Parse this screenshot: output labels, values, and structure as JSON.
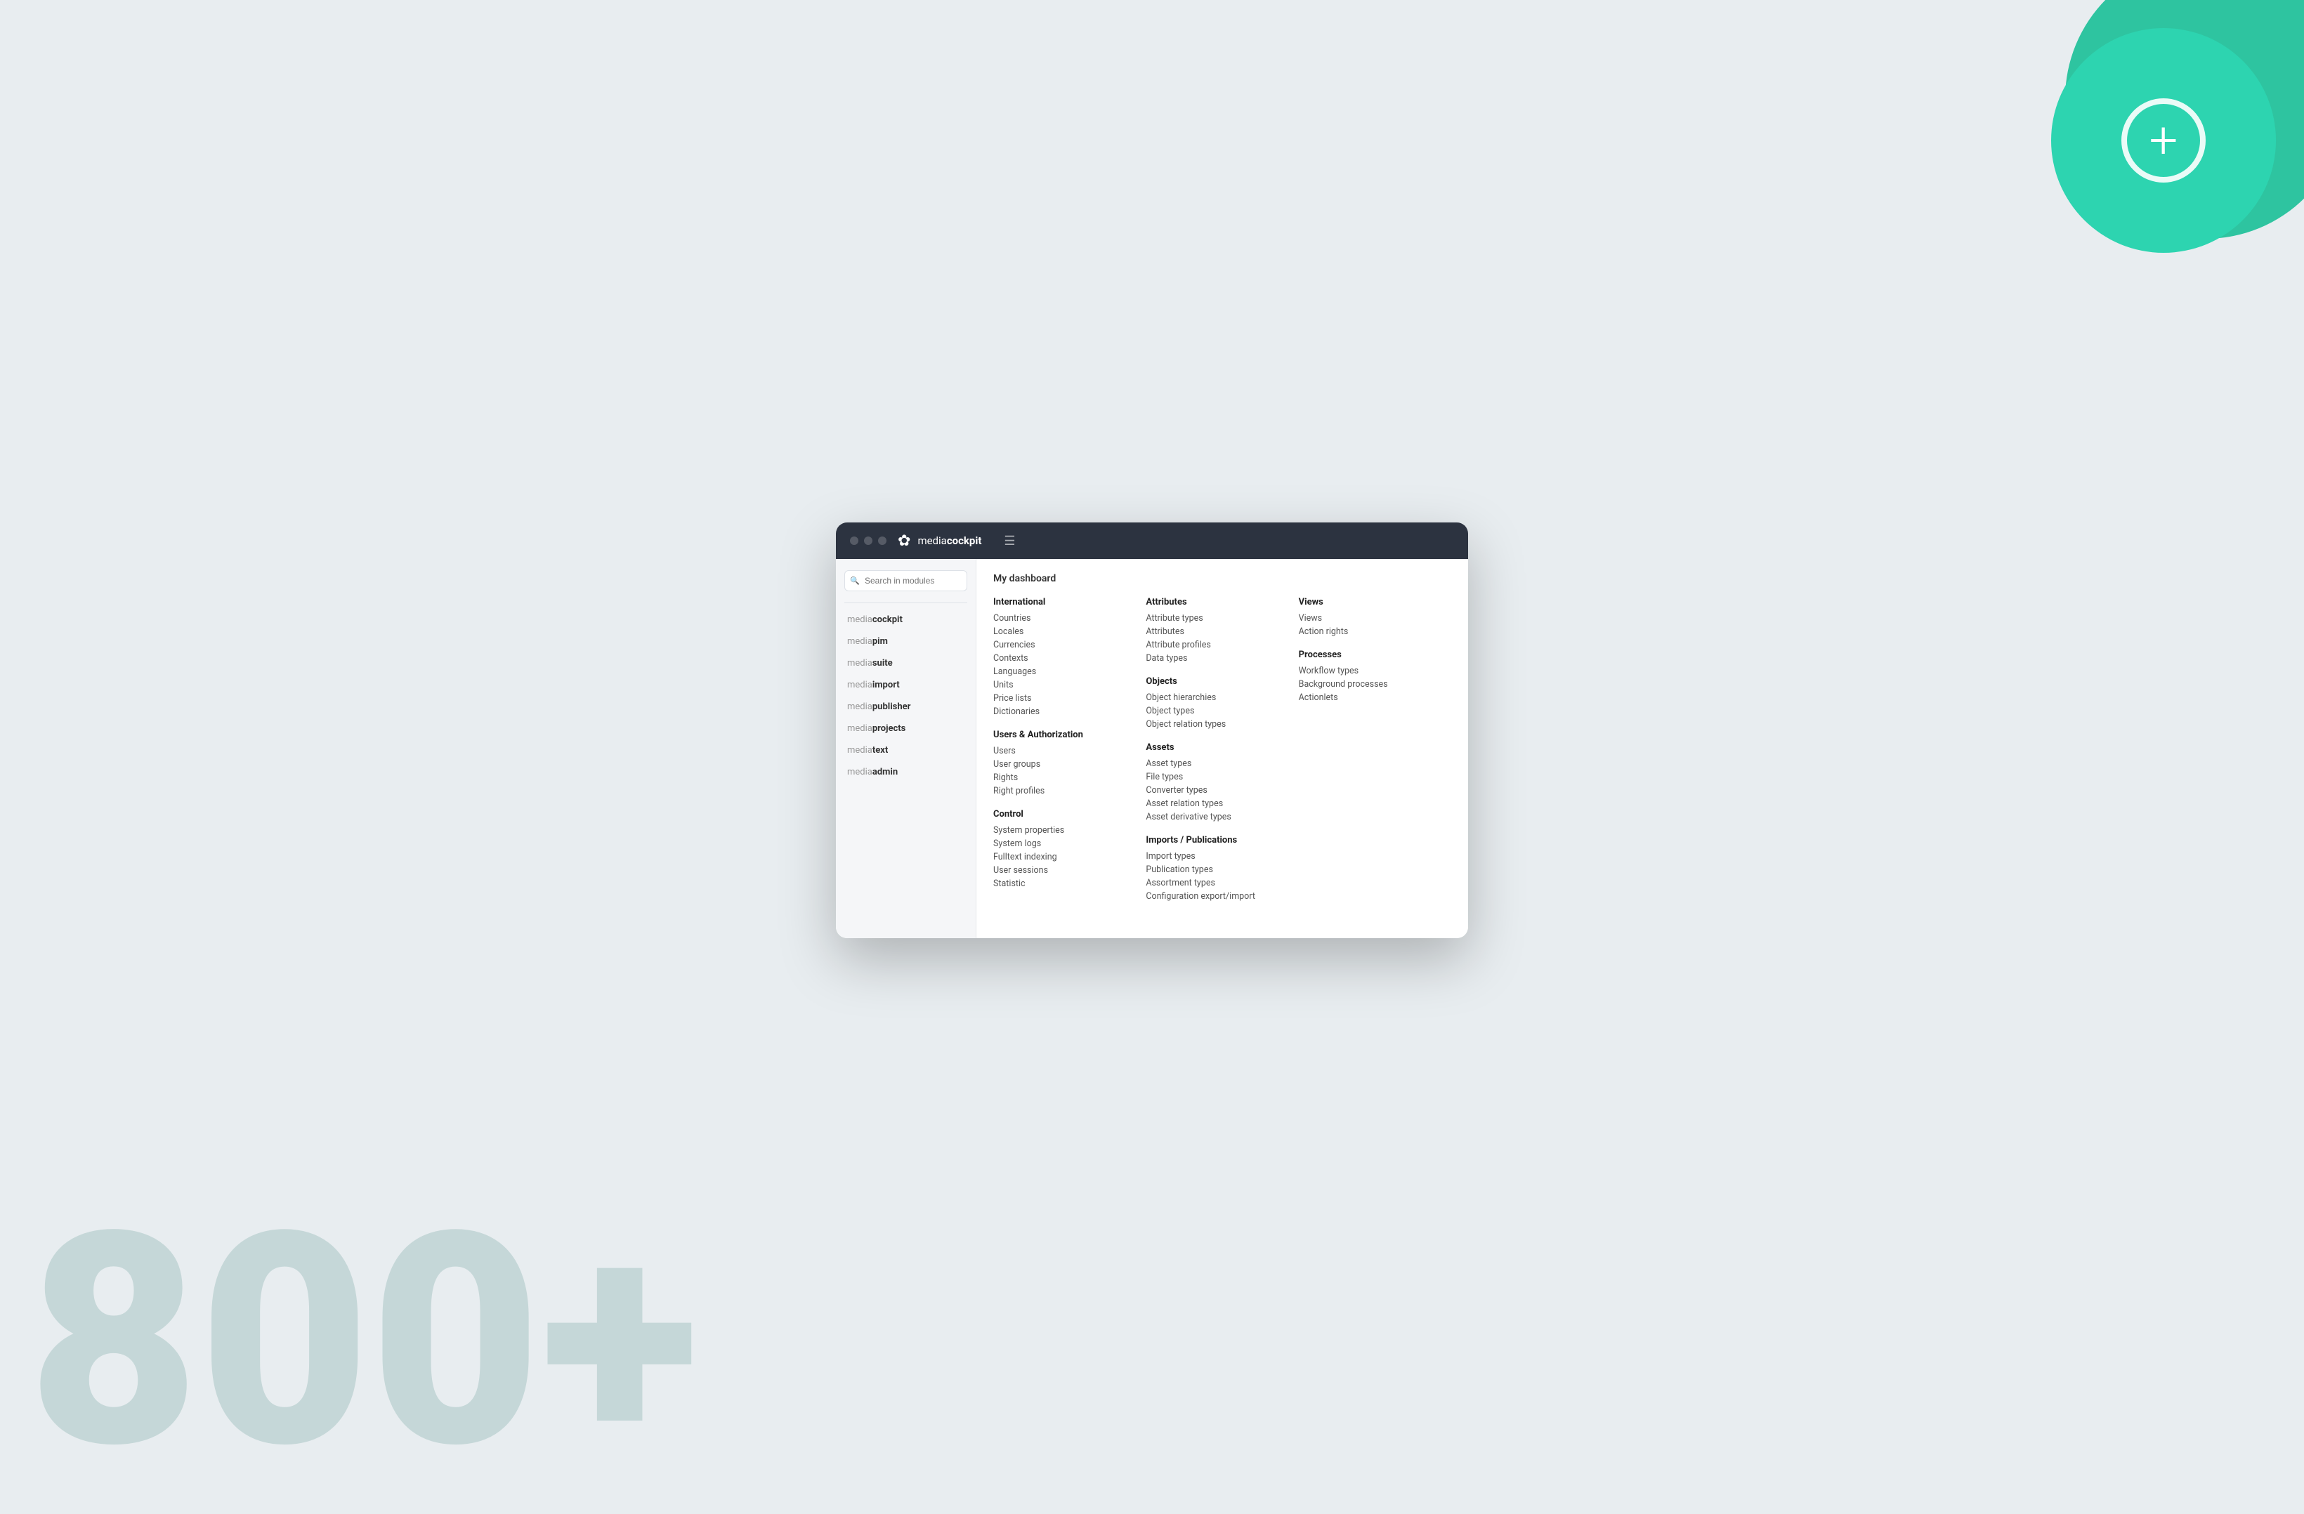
{
  "background": {
    "number": "800+",
    "circle_plus": "+"
  },
  "browser": {
    "toolbar": {
      "logo_prefix": "media",
      "logo_suffix": "cockpit",
      "hamburger": "☰"
    }
  },
  "sidebar": {
    "search_placeholder": "Search in modules",
    "items": [
      {
        "prefix": "media",
        "bold": "cockpit"
      },
      {
        "prefix": "media",
        "bold": "pim"
      },
      {
        "prefix": "media",
        "bold": "suite"
      },
      {
        "prefix": "media",
        "bold": "import"
      },
      {
        "prefix": "media",
        "bold": "publisher"
      },
      {
        "prefix": "media",
        "bold": "projects"
      },
      {
        "prefix": "media",
        "bold": "text"
      },
      {
        "prefix": "media",
        "bold": "admin"
      }
    ]
  },
  "dashboard": {
    "title": "My dashboard",
    "columns": [
      {
        "sections": [
          {
            "heading": "International",
            "links": [
              "Countries",
              "Locales",
              "Currencies",
              "Contexts",
              "Languages",
              "Units",
              "Price lists",
              "Dictionaries"
            ]
          },
          {
            "heading": "Users & Authorization",
            "links": [
              "Users",
              "User groups",
              "Rights",
              "Right profiles"
            ]
          },
          {
            "heading": "Control",
            "links": [
              "System properties",
              "System logs",
              "Fulltext indexing",
              "User sessions",
              "Statistic"
            ]
          }
        ]
      },
      {
        "sections": [
          {
            "heading": "Attributes",
            "links": [
              "Attribute types",
              "Attributes",
              "Attribute profiles",
              "Data types"
            ]
          },
          {
            "heading": "Objects",
            "links": [
              "Object hierarchies",
              "Object types",
              "Object relation types"
            ]
          },
          {
            "heading": "Assets",
            "links": [
              "Asset types",
              "File types",
              "Converter types",
              "Asset relation types",
              "Asset derivative types"
            ]
          },
          {
            "heading": "Imports / Publications",
            "links": [
              "Import types",
              "Publication types",
              "Assortment types",
              "Configuration export/import"
            ]
          }
        ]
      },
      {
        "sections": [
          {
            "heading": "Views",
            "links": [
              "Views",
              "Action rights"
            ]
          },
          {
            "heading": "Processes",
            "links": [
              "Workflow types",
              "Background processes",
              "Actionlets"
            ]
          }
        ]
      }
    ]
  }
}
